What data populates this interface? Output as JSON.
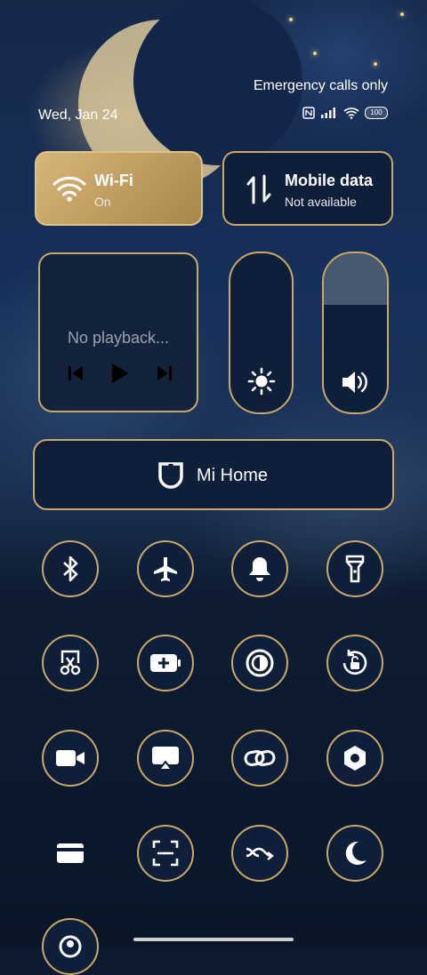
{
  "status": {
    "date": "Wed, Jan 24",
    "carrier_text": "Emergency calls only",
    "battery_level": "100"
  },
  "tiles": {
    "wifi": {
      "title": "Wi-Fi",
      "subtitle": "On"
    },
    "mobile_data": {
      "title": "Mobile data",
      "subtitle": "Not available"
    }
  },
  "media": {
    "status_text": "No playback..."
  },
  "sliders": {
    "brightness_level": 0.0,
    "volume_level": 0.7
  },
  "mi_home": {
    "label": "Mi Home"
  },
  "toggles": [
    {
      "icon": "bluetooth-icon"
    },
    {
      "icon": "airplane-icon"
    },
    {
      "icon": "bell-icon"
    },
    {
      "icon": "flashlight-icon"
    },
    {
      "icon": "screenshot-scissors-icon"
    },
    {
      "icon": "battery-saver-icon"
    },
    {
      "icon": "dark-contrast-icon"
    },
    {
      "icon": "rotation-lock-icon"
    },
    {
      "icon": "video-camera-icon"
    },
    {
      "icon": "cast-screen-icon"
    },
    {
      "icon": "link-icon"
    },
    {
      "icon": "hexagon-settings-icon"
    },
    {
      "icon": "card-icon"
    },
    {
      "icon": "scan-icon"
    },
    {
      "icon": "shuffle-icon"
    },
    {
      "icon": "moon-icon"
    },
    {
      "icon": "location-pin-icon"
    }
  ],
  "colors": {
    "accent_gold": "#caa966",
    "tile_dark": "#0f1f3a",
    "wifi_gold": "#d8b678"
  }
}
